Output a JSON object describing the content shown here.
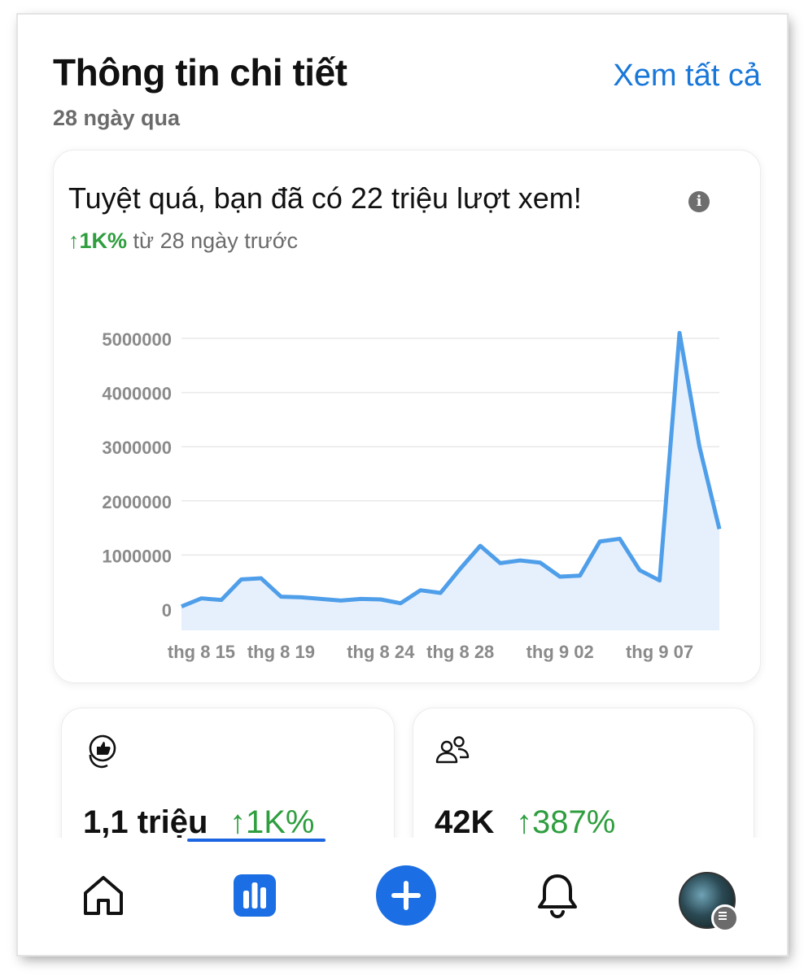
{
  "header": {
    "title": "Thông tin chi tiết",
    "see_all": "Xem tất cả",
    "period": "28 ngày qua"
  },
  "chart_card": {
    "headline": "Tuyệt quá, bạn đã có 22 triệu lượt xem!",
    "info_icon": "i",
    "change_value": "↑1K%",
    "change_text": " từ 28 ngày trước"
  },
  "chart_data": {
    "type": "area",
    "title": "",
    "xlabel": "",
    "ylabel": "",
    "ylim": [
      0,
      5300000
    ],
    "y_ticks": [
      0,
      1000000,
      2000000,
      3000000,
      4000000,
      5000000
    ],
    "y_tick_labels": [
      "0",
      "1000000",
      "2000000",
      "3000000",
      "4000000",
      "5000000"
    ],
    "x_tick_labels": [
      "thg 8 15",
      "thg 8 19",
      "thg 8 24",
      "thg 8 28",
      "thg 9 02",
      "thg 9 07"
    ],
    "x_tick_index": [
      1,
      5,
      10,
      14,
      19,
      24
    ],
    "values": [
      50000,
      200000,
      170000,
      550000,
      570000,
      230000,
      220000,
      190000,
      160000,
      190000,
      180000,
      110000,
      350000,
      300000,
      750000,
      1170000,
      850000,
      900000,
      860000,
      600000,
      620000,
      1250000,
      1300000,
      720000,
      530000,
      5100000,
      3000000,
      1480000
    ],
    "grid": true,
    "colors": {
      "line": "#4f9ee9",
      "fill": "#e6f0fd",
      "grid": "#e8e8e8"
    }
  },
  "stats": [
    {
      "icon": "like-reaction-icon",
      "value": "1,1 triệu",
      "change": "↑1K%"
    },
    {
      "icon": "followers-icon",
      "value": "42K",
      "change": "↑387%"
    }
  ],
  "nav": {
    "items": [
      "home-icon",
      "insights-icon",
      "create-icon",
      "notifications-icon",
      "profile-avatar"
    ]
  },
  "colors": {
    "accent": "#1877d9",
    "positive": "#2e9e3e",
    "muted": "#6b6b6b"
  }
}
